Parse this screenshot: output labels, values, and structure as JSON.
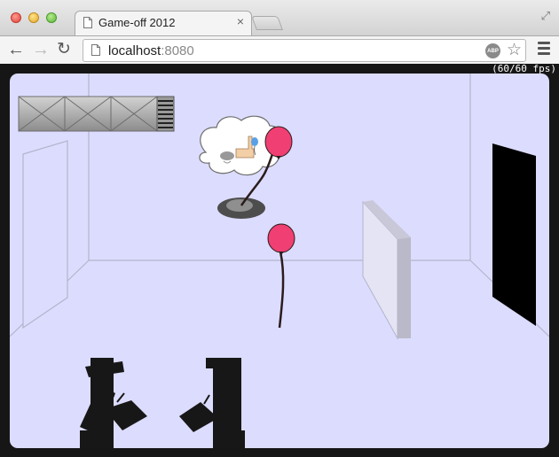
{
  "window": {
    "tab_title": "Game-off 2012",
    "tab_close": "×",
    "fullscreen_glyph": "⤢"
  },
  "toolbar": {
    "back_glyph": "←",
    "forward_glyph": "→",
    "reload_glyph": "↻",
    "url_host": "localhost",
    "url_port": ":8080",
    "adblock_label": "ABP",
    "star_glyph": "☆"
  },
  "game": {
    "fps_text": "(60/60 fps)",
    "colors": {
      "room": "#dcdcff",
      "room_lines": "#b4b4cc",
      "balloon": "#f03f72",
      "silhouette": "#171717",
      "door": "#000000"
    }
  }
}
